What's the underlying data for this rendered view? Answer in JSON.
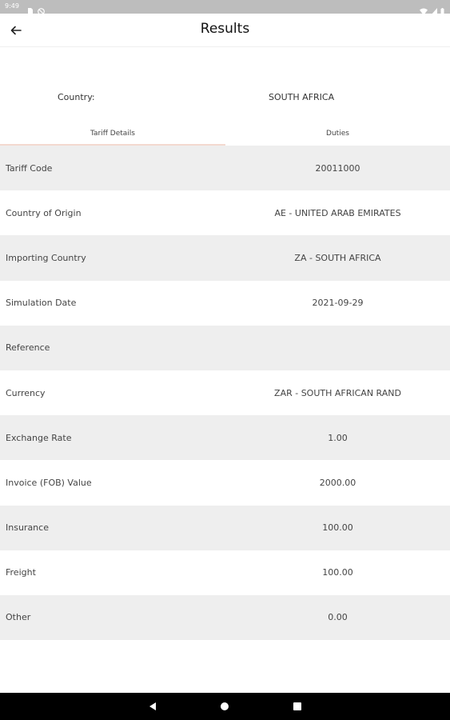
{
  "status_bar": {
    "time": "9:49"
  },
  "header": {
    "title": "Results"
  },
  "country": {
    "label": "Country:",
    "value": "SOUTH AFRICA"
  },
  "tabs": [
    {
      "label": "Tariff Details",
      "selected": true
    },
    {
      "label": "Duties",
      "selected": false
    }
  ],
  "rows": [
    {
      "label": "Tariff Code",
      "value": "20011000"
    },
    {
      "label": "Country of Origin",
      "value": "AE - UNITED ARAB EMIRATES"
    },
    {
      "label": "Importing Country",
      "value": "ZA - SOUTH AFRICA"
    },
    {
      "label": "Simulation Date",
      "value": "2021-09-29"
    },
    {
      "label": "Reference",
      "value": ""
    },
    {
      "label": "Currency",
      "value": "ZAR - SOUTH AFRICAN RAND"
    },
    {
      "label": "Exchange Rate",
      "value": "1.00"
    },
    {
      "label": "Invoice (FOB) Value",
      "value": "2000.00"
    },
    {
      "label": "Insurance",
      "value": "100.00"
    },
    {
      "label": "Freight",
      "value": "100.00"
    },
    {
      "label": "Other",
      "value": "0.00"
    }
  ],
  "colors": {
    "status_bar": "#bdbdbd",
    "row_shade": "#eeeeee",
    "tab_indicator": "#f3d9cf",
    "nav_bar": "#000000"
  },
  "icons": {
    "back": "arrow-left-icon",
    "nav_back": "triangle-back-icon",
    "nav_home": "circle-home-icon",
    "nav_recents": "square-recents-icon"
  }
}
